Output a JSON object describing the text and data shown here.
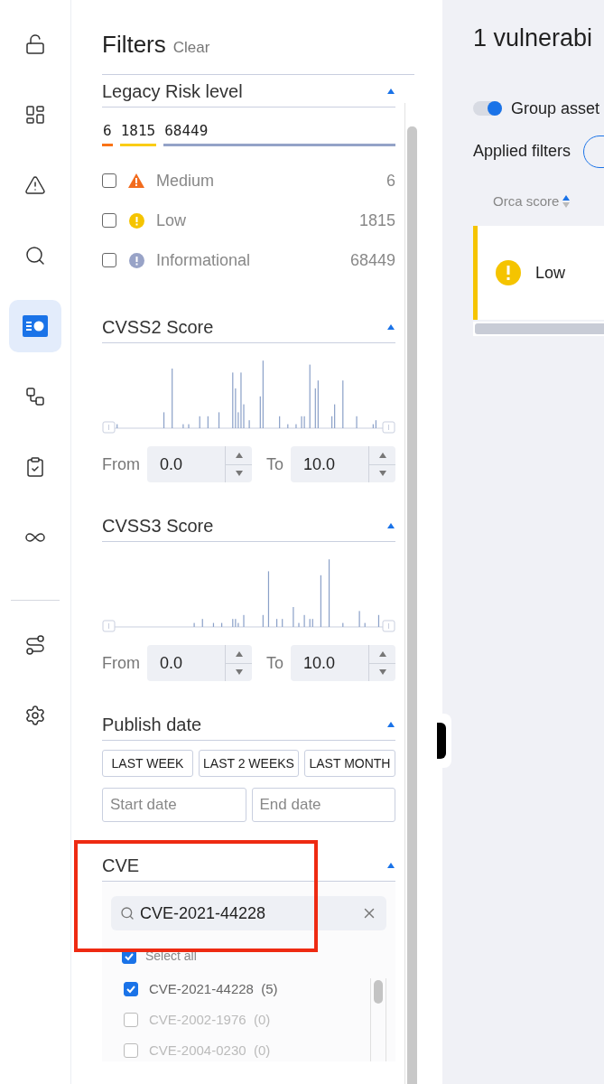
{
  "nav": {
    "items": [
      {
        "selected": false
      },
      {
        "selected": false
      },
      {
        "selected": false
      },
      {
        "selected": false
      },
      {
        "selected": true
      },
      {
        "selected": false
      },
      {
        "selected": false
      },
      {
        "selected": false
      },
      {
        "selected": false
      },
      {
        "selected": false
      }
    ]
  },
  "filters": {
    "title": "Filters",
    "clear": "Clear",
    "risk": {
      "title": "Legacy Risk level",
      "expanded": true,
      "segments": [
        {
          "count": "6",
          "color": "#f97316"
        },
        {
          "count": "1815",
          "color": "#facc15"
        },
        {
          "count": "68449",
          "color": "#94a3c8"
        }
      ],
      "items": [
        {
          "kind": "medium",
          "label": "Medium",
          "count": "6",
          "checked": false
        },
        {
          "kind": "low",
          "label": "Low",
          "count": "1815",
          "checked": false
        },
        {
          "kind": "info",
          "label": "Informational",
          "count": "68449",
          "checked": false
        }
      ]
    },
    "ranges": [
      {
        "title": "CVSS2 Score",
        "expanded": true,
        "from_label": "From",
        "from": "0.0",
        "to_label": "To",
        "to": "10.0"
      },
      {
        "title": "CVSS3 Score",
        "expanded": true,
        "from_label": "From",
        "from": "0.0",
        "to_label": "To",
        "to": "10.0"
      }
    ],
    "publish": {
      "title": "Publish date",
      "expanded": true,
      "buttons": [
        "LAST WEEK",
        "LAST 2 WEEKS",
        "LAST MONTH"
      ],
      "start_placeholder": "Start date",
      "end_placeholder": "End date"
    },
    "cve": {
      "title": "CVE",
      "expanded": true,
      "search": "CVE-2021-44228",
      "select_all": {
        "label": "Select all",
        "checked": true
      },
      "items": [
        {
          "label": "CVE-2021-44228",
          "count": "(5)",
          "checked": true,
          "disabled": false
        },
        {
          "label": "CVE-2002-1976",
          "count": "(0)",
          "checked": false,
          "disabled": true
        },
        {
          "label": "CVE-2004-0230",
          "count": "(0)",
          "checked": false,
          "disabled": true
        }
      ]
    }
  },
  "results": {
    "title": "1 vulnerabi",
    "group_toggle": {
      "label": "Group asset",
      "on": true
    },
    "applied_label": "Applied filters",
    "column": "Orca score",
    "rows": [
      {
        "kind": "low",
        "label": "Low",
        "color": "#f5c400"
      }
    ]
  }
}
